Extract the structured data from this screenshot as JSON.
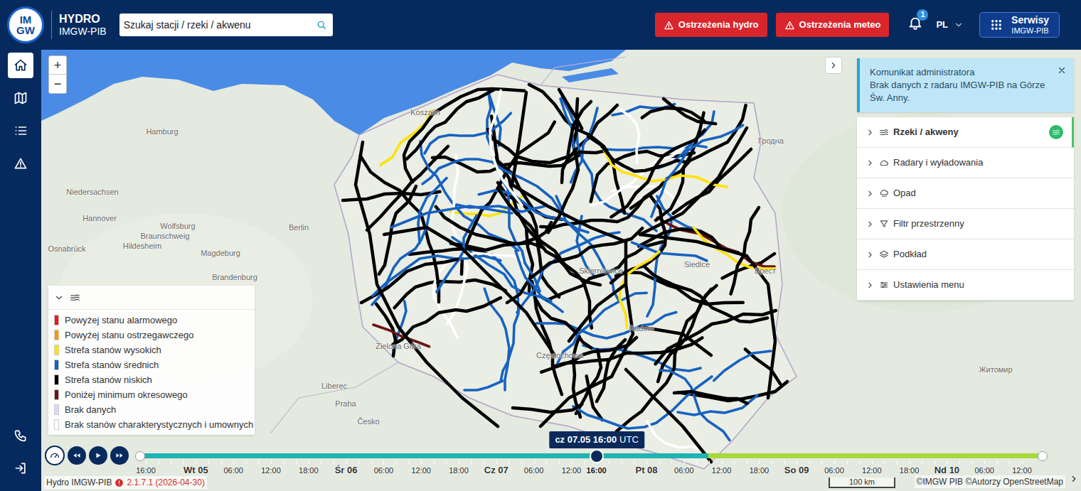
{
  "header": {
    "logo": {
      "top": "IM",
      "bottom": "GW"
    },
    "title": "HYDRO",
    "subtitle": "IMGW-PIB",
    "search": {
      "placeholder": "Szukaj stacji / rzeki / akwenu"
    },
    "warnings": [
      {
        "label": "Ostrzeżenia hydro"
      },
      {
        "label": "Ostrzeżenia meteo"
      }
    ],
    "notifications": {
      "count": "1"
    },
    "language": "PL",
    "services": {
      "label": "Serwisy",
      "sub": "IMGW-PIB"
    }
  },
  "sidebar": {
    "items": [
      {
        "selected": true
      },
      {
        "selected": false
      },
      {
        "selected": false
      },
      {
        "selected": false
      }
    ],
    "bottom_items": [
      {
        "selected": false
      },
      {
        "selected": false
      }
    ]
  },
  "map": {
    "zoom": {
      "in": "+",
      "out": "−"
    },
    "labels": [
      "Hamburg",
      "Hannover",
      "Berlin",
      "Magdeburg",
      "Wolfsburg",
      "Braunschweig",
      "Hildesheim",
      "Osnabrück",
      "Niedersachsen",
      "Brandenburg",
      "Liberec",
      "Praha",
      "Česko",
      "Гродна",
      "Брест",
      "Житомир",
      "Siedlce",
      "Radom",
      "Skierniewice",
      "Częstochowa",
      "Koszalin",
      "Zielona Góra"
    ]
  },
  "panel": {
    "message": {
      "title": "Komunikat administratora",
      "body": "Brak danych z radaru IMGW-PIB na Górze Św. Anny."
    },
    "items": [
      {
        "label": "Rzeki / akweny",
        "selected": true
      },
      {
        "label": "Radary i wyładowania",
        "selected": false
      },
      {
        "label": "Opad",
        "selected": false
      },
      {
        "label": "Filtr przestrzenny",
        "selected": false
      },
      {
        "label": "Podkład",
        "selected": false
      },
      {
        "label": "Ustawienia menu",
        "selected": false
      }
    ]
  },
  "legend": {
    "expanded": true,
    "items": [
      {
        "label": "Powyżej stanu alarmowego",
        "zone": "alarm",
        "color": "#e31a1a"
      },
      {
        "label": "Powyżej stanu ostrzegawczego",
        "zone": "warning",
        "color": "#f59a0b"
      },
      {
        "label": "Strefa stanów wysokich",
        "zone": "high",
        "color": "#ffe20a"
      },
      {
        "label": "Strefa stanów średnich",
        "zone": "medium",
        "color": "#1762bf"
      },
      {
        "label": "Strefa stanów niskich",
        "zone": "low",
        "color": "#000000"
      },
      {
        "label": "Poniżej minimum okresowego",
        "zone": "below_min",
        "color": "#6b1313"
      },
      {
        "label": "Brak danych",
        "zone": "no_data",
        "color": "#d9d9f7"
      },
      {
        "label": "Brak stanów charakterystycznych i umownych",
        "zone": "no_thresholds",
        "color": "#ffffff"
      }
    ]
  },
  "rivers": [
    {
      "zone": "low"
    },
    {
      "zone": "low"
    },
    {
      "zone": "low"
    },
    {
      "zone": "low"
    },
    {
      "zone": "low"
    },
    {
      "zone": "low"
    },
    {
      "zone": "low"
    },
    {
      "zone": "medium"
    },
    {
      "zone": "low"
    },
    {
      "zone": "low"
    },
    {
      "zone": "medium"
    },
    {
      "zone": "low"
    },
    {
      "zone": "low"
    },
    {
      "zone": "medium"
    },
    {
      "zone": "low"
    },
    {
      "zone": "high"
    },
    {
      "zone": "low"
    },
    {
      "zone": "medium"
    },
    {
      "zone": "low"
    },
    {
      "zone": "medium"
    },
    {
      "zone": "low"
    },
    {
      "zone": "low"
    },
    {
      "zone": "no_thresholds"
    },
    {
      "zone": "medium"
    },
    {
      "zone": "low"
    },
    {
      "zone": "medium"
    },
    {
      "zone": "low"
    },
    {
      "zone": "low"
    },
    {
      "zone": "medium"
    },
    {
      "zone": "low"
    },
    {
      "zone": "medium"
    },
    {
      "zone": "medium"
    },
    {
      "zone": "low"
    },
    {
      "zone": "low"
    },
    {
      "zone": "below_min"
    },
    {
      "zone": "low"
    },
    {
      "zone": "medium"
    },
    {
      "zone": "low"
    },
    {
      "zone": "low"
    },
    {
      "zone": "medium"
    },
    {
      "zone": "low"
    },
    {
      "zone": "no_thresholds"
    },
    {
      "zone": "low"
    },
    {
      "zone": "medium"
    },
    {
      "zone": "medium"
    },
    {
      "zone": "low"
    },
    {
      "zone": "high"
    },
    {
      "zone": "low"
    },
    {
      "zone": "medium"
    },
    {
      "zone": "low"
    },
    {
      "zone": "low"
    },
    {
      "zone": "medium"
    },
    {
      "zone": "low"
    },
    {
      "zone": "medium"
    },
    {
      "zone": "low"
    },
    {
      "zone": "no_thresholds"
    },
    {
      "zone": "medium"
    },
    {
      "zone": "low"
    },
    {
      "zone": "low"
    },
    {
      "zone": "medium"
    },
    {
      "zone": "low"
    },
    {
      "zone": "low"
    },
    {
      "zone": "medium"
    },
    {
      "zone": "high"
    },
    {
      "zone": "low"
    },
    {
      "zone": "medium"
    },
    {
      "zone": "low"
    },
    {
      "zone": "medium"
    },
    {
      "zone": "low"
    },
    {
      "zone": "low"
    },
    {
      "zone": "medium"
    },
    {
      "zone": "low"
    },
    {
      "zone": "no_thresholds"
    },
    {
      "zone": "low"
    },
    {
      "zone": "medium"
    },
    {
      "zone": "low"
    },
    {
      "zone": "low"
    },
    {
      "zone": "medium"
    },
    {
      "zone": "below_min"
    },
    {
      "zone": "medium"
    },
    {
      "zone": "low"
    },
    {
      "zone": "medium"
    },
    {
      "zone": "low"
    },
    {
      "zone": "low"
    },
    {
      "zone": "medium"
    },
    {
      "zone": "low"
    },
    {
      "zone": "high"
    },
    {
      "zone": "low"
    },
    {
      "zone": "medium"
    },
    {
      "zone": "low"
    },
    {
      "zone": "no_thresholds"
    },
    {
      "zone": "medium"
    },
    {
      "zone": "low"
    },
    {
      "zone": "medium"
    },
    {
      "zone": "low"
    },
    {
      "zone": "low"
    },
    {
      "zone": "medium"
    },
    {
      "zone": "low"
    },
    {
      "zone": "low"
    },
    {
      "zone": "medium"
    },
    {
      "zone": "low"
    },
    {
      "zone": "low"
    },
    {
      "zone": "medium"
    },
    {
      "zone": "low"
    },
    {
      "zone": "no_thresholds"
    },
    {
      "zone": "medium"
    },
    {
      "zone": "low"
    },
    {
      "zone": "high"
    },
    {
      "zone": "low"
    },
    {
      "zone": "low"
    },
    {
      "zone": "medium"
    },
    {
      "zone": "low"
    },
    {
      "zone": "low"
    },
    {
      "zone": "medium"
    },
    {
      "zone": "low"
    },
    {
      "zone": "medium"
    },
    {
      "zone": "low"
    },
    {
      "zone": "no_thresholds"
    },
    {
      "zone": "medium"
    }
  ],
  "timeline": {
    "current": {
      "time": "cz 07.05 16:00",
      "zone": "UTC"
    },
    "level": 0.506,
    "observed_share": 0.63,
    "ticks": [
      {
        "label": "16:00",
        "kind": "hour"
      },
      {
        "label": "Wt 05",
        "kind": "day"
      },
      {
        "label": "06:00",
        "kind": "hour"
      },
      {
        "label": "12:00",
        "kind": "hour"
      },
      {
        "label": "18:00",
        "kind": "hour"
      },
      {
        "label": "Śr 06",
        "kind": "day"
      },
      {
        "label": "06:00",
        "kind": "hour"
      },
      {
        "label": "12:00",
        "kind": "hour"
      },
      {
        "label": "18:00",
        "kind": "hour"
      },
      {
        "label": "Cz 07",
        "kind": "day"
      },
      {
        "label": "06:00",
        "kind": "hour"
      },
      {
        "label": "12:00",
        "kind": "hour"
      },
      {
        "label": "16:00",
        "kind": "current"
      },
      {
        "label": "Pt 08",
        "kind": "day"
      },
      {
        "label": "06:00",
        "kind": "hour"
      },
      {
        "label": "12:00",
        "kind": "hour"
      },
      {
        "label": "18:00",
        "kind": "hour"
      },
      {
        "label": "So 09",
        "kind": "day"
      },
      {
        "label": "06:00",
        "kind": "hour"
      },
      {
        "label": "12:00",
        "kind": "hour"
      },
      {
        "label": "18:00",
        "kind": "hour"
      },
      {
        "label": "Nd 10",
        "kind": "day"
      },
      {
        "label": "06:00",
        "kind": "hour"
      },
      {
        "label": "12:00",
        "kind": "hour"
      }
    ]
  },
  "footer": {
    "app": "Hydro IMGW-PIB",
    "version": "2.1.7.1 (2026-04-30)",
    "scale": "100 km",
    "attribution": "©IMGW PIB ©Autorzy OpenStreetMap"
  }
}
